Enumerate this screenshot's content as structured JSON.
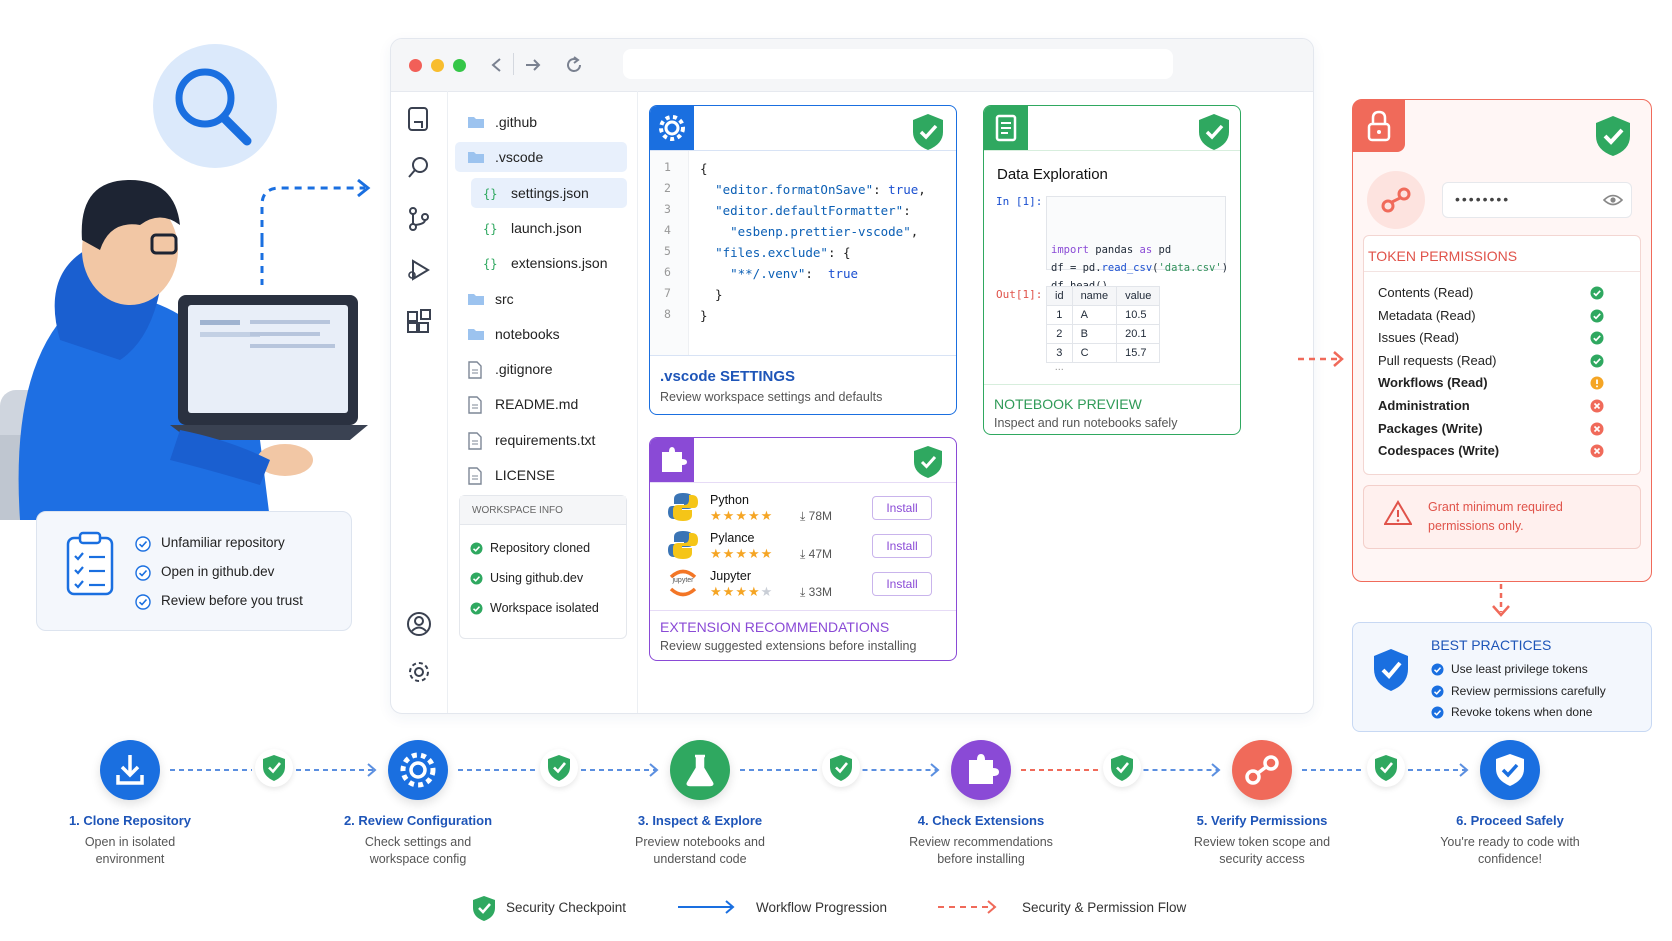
{
  "browser": {
    "explorer": {
      "items": [
        {
          "label": ".github",
          "icon": "folder-icon"
        },
        {
          "label": ".vscode",
          "icon": "folder-icon"
        },
        {
          "label": "settings.json",
          "icon": "json-icon"
        },
        {
          "label": "launch.json",
          "icon": "json-icon"
        },
        {
          "label": "extensions.json",
          "icon": "json-icon"
        },
        {
          "label": "src",
          "icon": "folder-icon"
        },
        {
          "label": "notebooks",
          "icon": "folder-icon"
        },
        {
          "label": ".gitignore",
          "icon": "file-icon"
        },
        {
          "label": "README.md",
          "icon": "file-icon"
        },
        {
          "label": "requirements.txt",
          "icon": "file-icon"
        },
        {
          "label": "LICENSE",
          "icon": "file-icon"
        }
      ],
      "workspace_info": {
        "title": "WORKSPACE INFO",
        "items": [
          "Repository cloned",
          "Using github.dev",
          "Workspace isolated"
        ]
      }
    },
    "settings_card": {
      "line_numbers": [
        "1",
        "2",
        "3",
        "4",
        "5",
        "6",
        "7",
        "8"
      ],
      "title": ".vscode SETTINGS",
      "subtitle": "Review workspace settings and defaults"
    },
    "notebook_card": {
      "heading": "Data Exploration",
      "in_prompt": "In [1]:",
      "code": [
        "import pandas as pd",
        "df = pd.read_csv('data.csv')",
        "df.head()"
      ],
      "out_prompt": "Out[1]:",
      "table": {
        "headers": [
          "id",
          "name",
          "value"
        ],
        "rows": [
          [
            "1",
            "A",
            "10.5"
          ],
          [
            "2",
            "B",
            "20.1"
          ],
          [
            "3",
            "C",
            "15.7"
          ]
        ],
        "more": "..."
      },
      "title": "NOTEBOOK PREVIEW",
      "subtitle": "Inspect and run notebooks safely"
    },
    "extensions_card": {
      "items": [
        {
          "name": "Python",
          "downloads": "78M",
          "stars": 5,
          "button": "Install"
        },
        {
          "name": "Pylance",
          "downloads": "47M",
          "stars": 5,
          "button": "Install"
        },
        {
          "name": "Jupyter",
          "downloads": "33M",
          "stars": 4,
          "button": "Install"
        }
      ],
      "jupyter_logo_text": "jupyter",
      "title": "EXTENSION RECOMMENDATIONS",
      "subtitle": "Review suggested extensions before installing"
    }
  },
  "intro_panel": {
    "items": [
      "Unfamiliar repository",
      "Open in github.dev",
      "Review before you trust"
    ]
  },
  "token_panel": {
    "password_mask": "••••••••",
    "title": "TOKEN PERMISSIONS",
    "permissions": [
      {
        "label": "Contents (Read)",
        "status": "ok",
        "bold": false
      },
      {
        "label": "Metadata (Read)",
        "status": "ok",
        "bold": false
      },
      {
        "label": "Issues (Read)",
        "status": "ok",
        "bold": false
      },
      {
        "label": "Pull requests (Read)",
        "status": "ok",
        "bold": false
      },
      {
        "label": "Workflows (Read)",
        "status": "warn",
        "bold": true
      },
      {
        "label": "Administration",
        "status": "deny",
        "bold": true
      },
      {
        "label": "Packages (Write)",
        "status": "deny",
        "bold": true
      },
      {
        "label": "Codespaces (Write)",
        "status": "deny",
        "bold": true
      }
    ],
    "warning": "Grant minimum required permissions only."
  },
  "best_practices": {
    "title": "BEST PRACTICES",
    "items": [
      "Use least privilege tokens",
      "Review permissions carefully",
      "Revoke tokens when done"
    ]
  },
  "steps": [
    {
      "title": "1. Clone Repository",
      "desc": "Open in isolated environment",
      "color": "#1a6fe0",
      "icon": "download-icon"
    },
    {
      "title": "2. Review Configuration",
      "desc": "Check settings and workspace config",
      "color": "#1a6fe0",
      "icon": "gear-icon"
    },
    {
      "title": "3. Inspect & Explore",
      "desc": "Preview notebooks and understand code",
      "color": "#2fa860",
      "icon": "flask-icon"
    },
    {
      "title": "4. Check Extensions",
      "desc": "Review recommendations before installing",
      "color": "#8a4ad6",
      "icon": "puzzle-icon"
    },
    {
      "title": "5. Verify Permissions",
      "desc": "Review token scope and security access",
      "color": "#f06a5a",
      "icon": "key-icon"
    },
    {
      "title": "6. Proceed Safely",
      "desc": "You're ready to code with confidence!",
      "color": "#1a6fe0",
      "icon": "shield-icon"
    }
  ],
  "legend": {
    "checkpoint": "Security Checkpoint",
    "progression": "Workflow Progression",
    "flow": "Security & Permission Flow"
  },
  "colors": {
    "blue": "#1a6fe0",
    "green": "#2fa860",
    "purple": "#8a4ad6",
    "red": "#f06a5a",
    "orange": "#f5a524"
  }
}
